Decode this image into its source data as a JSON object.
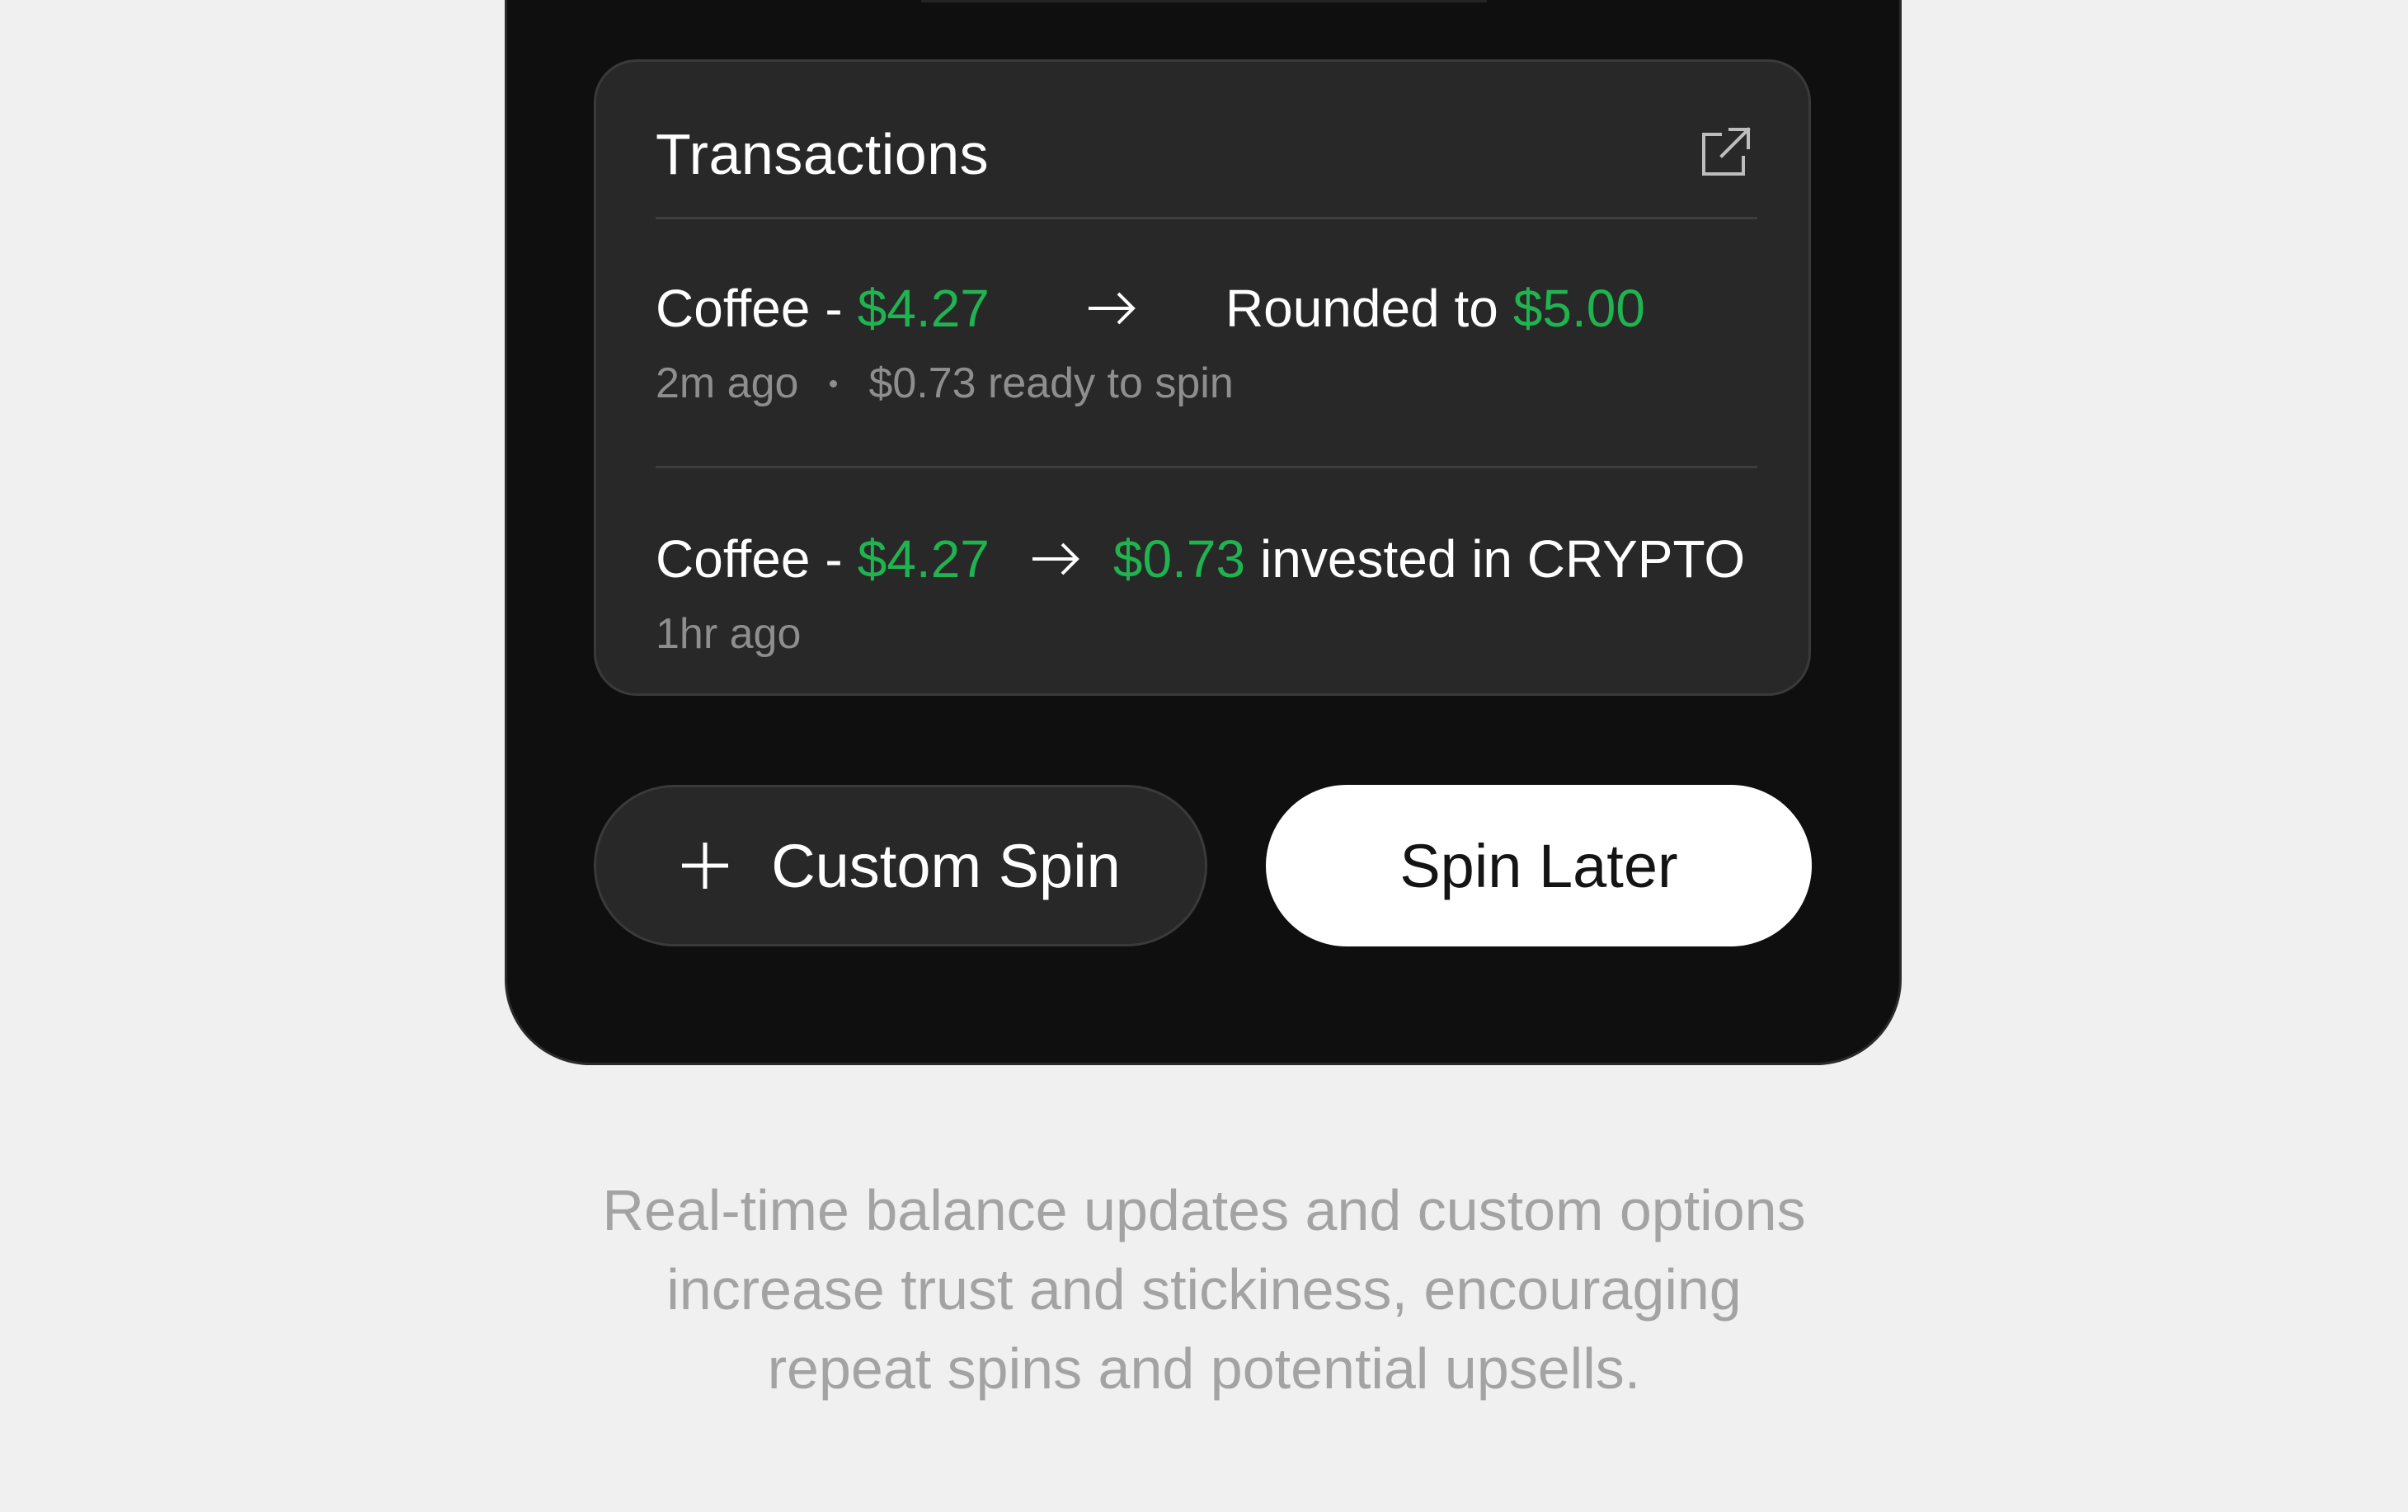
{
  "transactions_card": {
    "title": "Transactions",
    "open_icon": "external-link-icon",
    "items": [
      {
        "merchant": "Coffee",
        "separator": "-",
        "amount": "$4.27",
        "arrow": "arrow-right-icon",
        "result_prefix": "Rounded to",
        "result_amount": "$5.00",
        "time": "2m ago",
        "note": "$0.73 ready to spin"
      },
      {
        "merchant": "Coffee",
        "separator": "-",
        "amount": "$4.27",
        "arrow": "arrow-right-icon",
        "result_amount": "$0.73",
        "result_suffix": "invested in CRYPTO",
        "time": "1hr ago"
      }
    ]
  },
  "actions": {
    "custom_spin": {
      "icon": "plus-icon",
      "label": "Custom Spin"
    },
    "spin_later": {
      "label": "Spin Later"
    }
  },
  "caption": {
    "lines": [
      "Real-time balance updates and custom options",
      "increase trust and stickiness, encouraging",
      "repeat spins and potential upsells."
    ]
  },
  "colors": {
    "background": "#f0f0f0",
    "phone": "#0f0f0f",
    "card": "#282828",
    "accent_green": "#1fb450",
    "caption_text": "#a3a3a3"
  }
}
